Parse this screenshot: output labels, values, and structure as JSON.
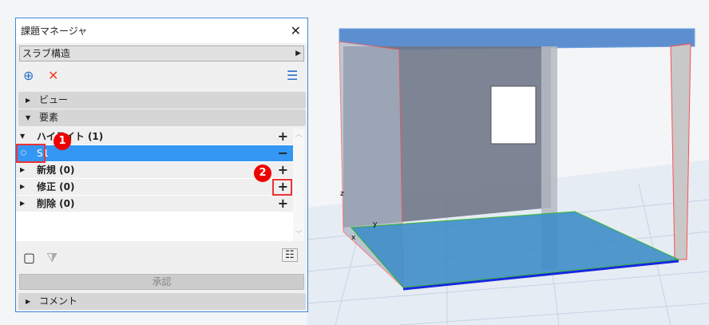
{
  "dialog": {
    "title": "課題マネージャ",
    "issue": "スラブ構造",
    "sections": {
      "view": "ビュー",
      "elements": "要素",
      "comment": "コメント"
    },
    "rows": [
      {
        "label": "ハイライト (1)",
        "action": "+"
      },
      {
        "label": "S1",
        "action": "−"
      },
      {
        "label": "新規 (0)",
        "action": "+"
      },
      {
        "label": "修正 (0)",
        "action": "+"
      },
      {
        "label": "削除 (0)",
        "action": "+"
      }
    ],
    "approve": "承認"
  },
  "callouts": [
    "1",
    "2"
  ],
  "axes": {
    "x": "x",
    "y": "y",
    "z": "z"
  }
}
